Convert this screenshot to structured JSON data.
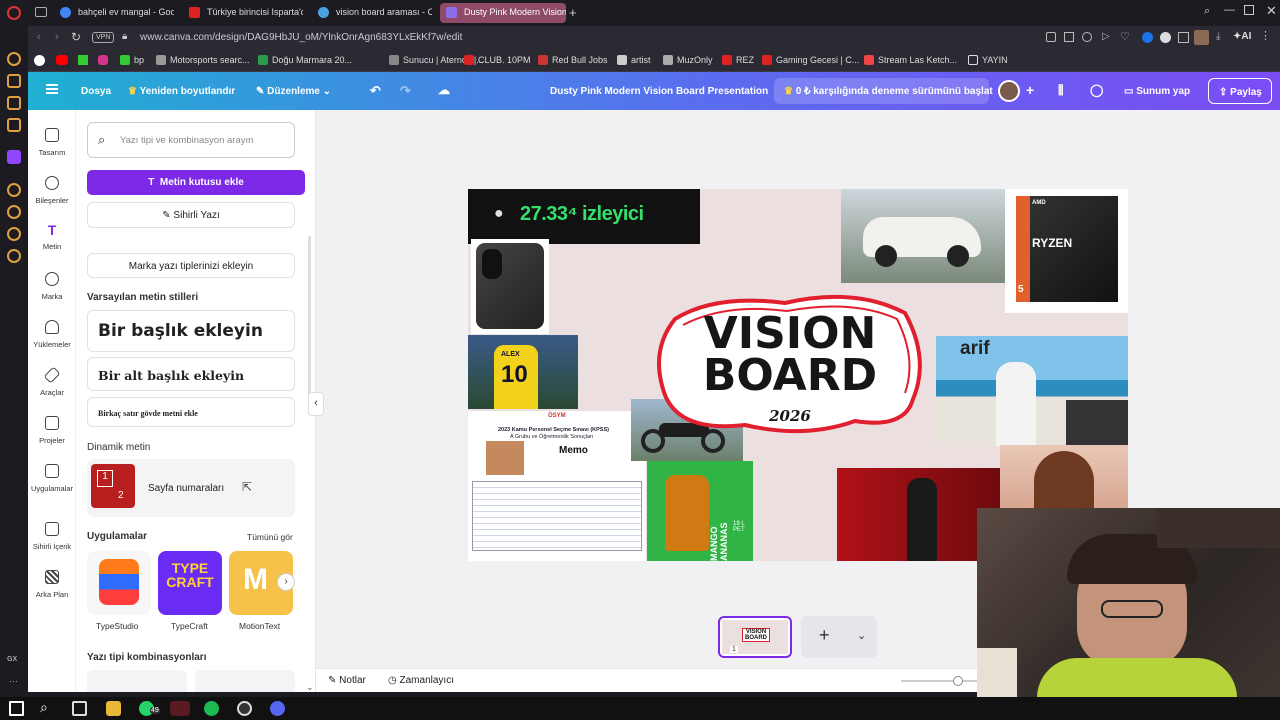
{
  "browser": {
    "tabs": [
      {
        "label": "bahçeli ev mangal - Googl",
        "color": "#4285f4"
      },
      {
        "label": "Türkiye birincisi Isparta'da",
        "color": "#d22"
      },
      {
        "label": "vision board araması - Ca",
        "color": "#4aa3df"
      },
      {
        "label": "Dusty Pink Modern Vision",
        "color": "#8e6ee8"
      }
    ],
    "vpn": "VPN",
    "url": "www.canva.com/design/DAG9HbJU_oM/YlnkOnrAgn683YLxEkKf7w/edit",
    "bookmarks": [
      {
        "label": "bp",
        "color": "#3c3"
      },
      {
        "label": "Motorsports searc...",
        "color": "#999"
      },
      {
        "label": "Doğu Marmara 20...",
        "color": "#2a9d4a"
      },
      {
        "label": "Sunucu | Aternos |...",
        "color": "#888"
      },
      {
        "label": "CLUB. 10PM",
        "color": "#d22"
      },
      {
        "label": "Red Bull Jobs",
        "color": "#c33"
      },
      {
        "label": "artist",
        "color": "#ccc"
      },
      {
        "label": "MuzOnly",
        "color": "#aaa"
      },
      {
        "label": "REZ",
        "color": "#d22"
      },
      {
        "label": "Gaming Gecesi | C...",
        "color": "#d22"
      },
      {
        "label": "Stream Las Ketch...",
        "color": "#e44"
      },
      {
        "label": "YAYIN",
        "color": "#ddd"
      }
    ],
    "ai_label": "AI"
  },
  "header": {
    "file": "Dosya",
    "resize": "Yeniden boyutlandır",
    "edit": "Düzenleme",
    "title": "Dusty Pink Modern Vision Board Presentation",
    "trial": "0 ₺ karşılığında deneme sürümünü başlat",
    "present": "Sunum yap",
    "share": "Paylaş"
  },
  "sidebar": [
    {
      "label": "Tasarım"
    },
    {
      "label": "Bileşenler"
    },
    {
      "label": "Metin"
    },
    {
      "label": "Marka"
    },
    {
      "label": "Yüklemeler"
    },
    {
      "label": "Araçlar"
    },
    {
      "label": "Projeler"
    },
    {
      "label": "Uygulamalar"
    },
    {
      "label": "Sihirli İçerik"
    },
    {
      "label": "Arka Plan"
    }
  ],
  "panel": {
    "search_placeholder": "Yazı tipi ve kombinasyon arayın",
    "add_textbox": "Metin kutusu ekle",
    "magic_write": "Sihirli Yazı",
    "brand_fonts": "Marka yazı tiplerinizi ekleyin",
    "default_styles": "Varsayılan metin stilleri",
    "heading": "Bir başlık ekleyin",
    "subheading": "Bir alt başlık ekleyin",
    "body": "Birkaç satır gövde metni ekle",
    "dynamic": "Dinamik metin",
    "page_numbers": "Sayfa numaraları",
    "page_icon_1": "1",
    "page_icon_2": "2",
    "apps": "Uygulamalar",
    "see_all": "Tümünü gör",
    "app_list": [
      {
        "label": "TypeStudio"
      },
      {
        "label": "TypeCraft"
      },
      {
        "label": "MotionText"
      }
    ],
    "app_logo_text": "TYPE CRAFT",
    "combos": "Yazı tipi kombinasyonları"
  },
  "slide": {
    "viewers": "27.33⁴ izleyici",
    "vision": "VISION",
    "board": "BOARD",
    "year": "2026",
    "arif": "arif",
    "memo": "Memo",
    "osym": "ÖSYM",
    "kpss_line1": "2023 Kamu Personel Seçme Sınavı (KPSS)",
    "kpss_line2": "A Grubu ve Öğretmenlik Sonuçları",
    "jersey": "10",
    "jersey_name": "ALEX",
    "ryzen": "RYZEN",
    "amd": "AMD",
    "ryzen_num": "5",
    "mango": "MANGO ANANAS",
    "litre": "19 L PET"
  },
  "bottom": {
    "notes": "Notlar",
    "timer": "Zamanlayıcı",
    "add_page": "+",
    "thumb_vision": "VISION BOARD",
    "thumb_page": "1"
  },
  "taskbar": {
    "badge": "49"
  },
  "colors": {
    "accent": "#7d2ae8",
    "tab_active": "#8e4a66",
    "slide_bg": "#ebe0df",
    "red": "#e0202f"
  }
}
